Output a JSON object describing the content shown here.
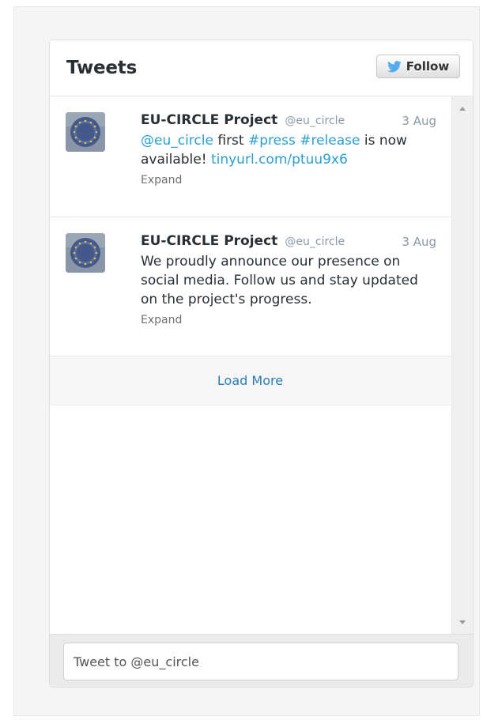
{
  "widget": {
    "title": "Tweets",
    "follow_label": "Follow",
    "bird_color": "#55acee",
    "link_color": "#2b9fd3"
  },
  "tweets": [
    {
      "name": "EU-CIRCLE Project",
      "handle": "@eu_circle",
      "date": "3 Aug",
      "text_parts": {
        "mention": "@eu_circle",
        "t1": " first ",
        "hashtag1": "#press",
        "t2": " ",
        "hashtag2": "#release",
        "t3": " is now available! ",
        "url": "tinyurl.com/ptuu9x6"
      },
      "expand": "Expand"
    },
    {
      "name": "EU-CIRCLE Project",
      "handle": "@eu_circle",
      "date": "3 Aug",
      "text": "We proudly announce our presence on social media. Follow us and stay updated on the project's progress.",
      "expand": "Expand"
    }
  ],
  "load_more": "Load More",
  "composer": {
    "placeholder": "Tweet to @eu_circle"
  }
}
